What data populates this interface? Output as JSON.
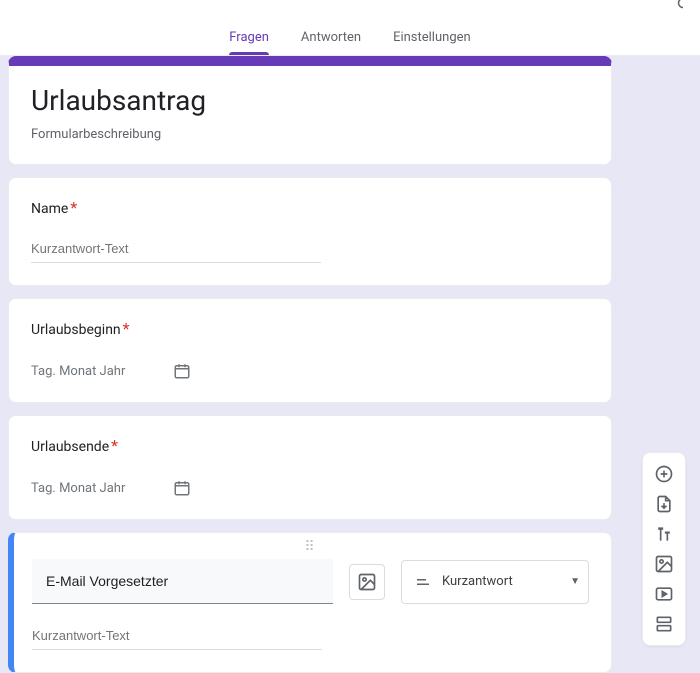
{
  "tabs": {
    "questions": "Fragen",
    "answers": "Antworten",
    "settings": "Einstellungen"
  },
  "form": {
    "title": "Urlaubsantrag",
    "description": "Formularbeschreibung"
  },
  "q1": {
    "label": "Name",
    "placeholder": "Kurzantwort-Text"
  },
  "q2": {
    "label": "Urlaubsbeginn",
    "datePlaceholder": "Tag. Monat Jahr"
  },
  "q3": {
    "label": "Urlaubsende",
    "datePlaceholder": "Tag. Monat Jahr"
  },
  "q4": {
    "title": "E-Mail Vorgesetzter",
    "typeLabel": "Kurzantwort",
    "placeholder": "Kurzantwort-Text"
  },
  "req": "*"
}
